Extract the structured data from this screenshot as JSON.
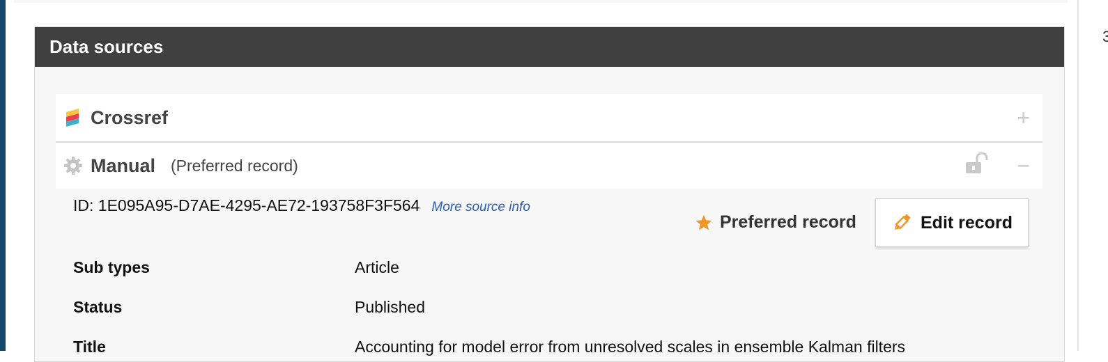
{
  "panel": {
    "title": "Data sources"
  },
  "sources": {
    "crossref": {
      "name": "Crossref",
      "icon": "crossref-logo-icon",
      "action_icon": "plus-icon",
      "action_symbol": "+"
    },
    "manual": {
      "name": "Manual",
      "note": "(Preferred record)",
      "icon": "gear-icon",
      "lock_icon": "unlock-icon",
      "action_icon": "minus-icon",
      "action_symbol": "−"
    }
  },
  "record": {
    "id_text": "ID: 1E095A95-D7AE-4295-AE72-193758F3F564",
    "more_info_link": "More source info",
    "preferred_label": "Preferred record",
    "edit_label": "Edit record"
  },
  "fields": [
    {
      "label": "Sub types",
      "value": "Article"
    },
    {
      "label": "Status",
      "value": "Published"
    },
    {
      "label": "Title",
      "value": "Accounting for model error from unresolved scales in ensemble Kalman filters"
    }
  ],
  "edge": {
    "right_char": "3"
  },
  "colors": {
    "header_bg": "#404040",
    "accent_orange": "#f0962a",
    "link_blue": "#2a5db0",
    "left_stripe": "#13476b"
  }
}
